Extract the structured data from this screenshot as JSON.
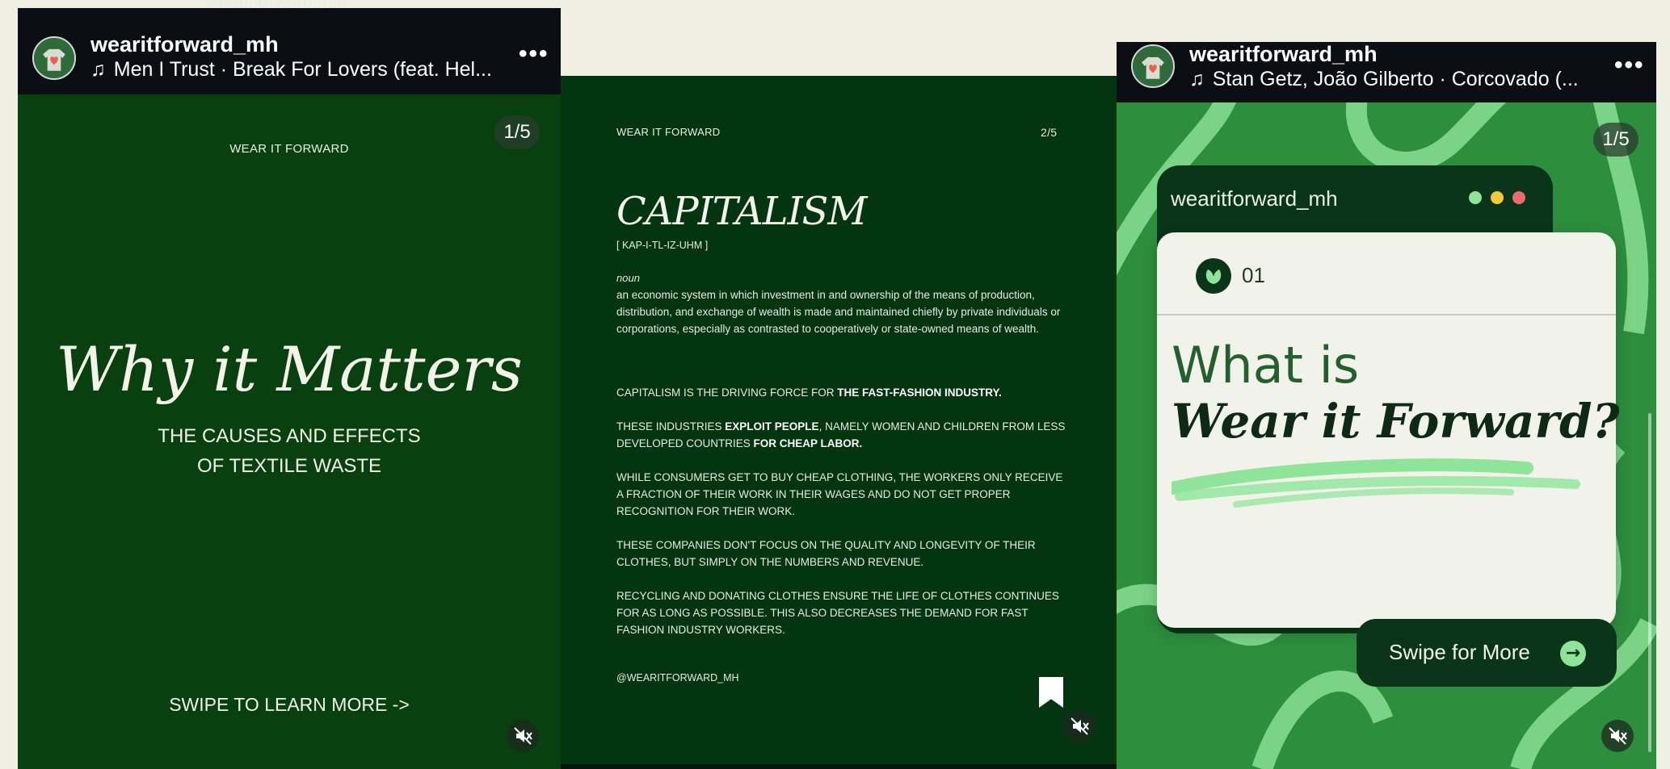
{
  "top_cutoff_text": "wearitforward_mh",
  "panel1": {
    "username": "wearitforward_mh",
    "song": "Men I Trust · Break For Lovers (feat. Hel...",
    "counter": "1/5",
    "brand": "WEAR IT FORWARD",
    "title": "Why it Matters",
    "subtitle_line1": "THE CAUSES AND EFFECTS",
    "subtitle_line2": "OF TEXTILE WASTE",
    "cta": "SWIPE TO LEARN MORE ->"
  },
  "panel2": {
    "brand": "WEAR IT FORWARD",
    "counter": "2/5",
    "heading": "CAPITALISM",
    "pronunciation": "[ KAP-I-TL-IZ-UHM ]",
    "pos": "noun",
    "definition": "an economic system in which investment in and ownership of the means of production, distribution, and exchange of wealth is made and maintained chiefly by private individuals or corporations, especially as contrasted to cooperatively or state-owned means of wealth.",
    "p1_a": "CAPITALISM IS THE DRIVING FORCE FOR ",
    "p1_b": "THE FAST-FASHION INDUSTRY.",
    "p2_a": "THESE INDUSTRIES ",
    "p2_b": "EXPLOIT PEOPLE",
    "p2_c": ", NAMELY WOMEN AND CHILDREN FROM LESS DEVELOPED COUNTRIES ",
    "p2_d": "FOR CHEAP LABOR.",
    "p3": "WHILE CONSUMERS GET TO BUY CHEAP CLOTHING, THE WORKERS ONLY RECEIVE A FRACTION OF THEIR WORK IN THEIR WAGES AND DO NOT GET PROPER RECOGNITION FOR THEIR WORK.",
    "p4": "THESE COMPANIES DON'T FOCUS ON THE QUALITY AND LONGEVITY OF THEIR CLOTHES, BUT SIMPLY ON THE NUMBERS AND REVENUE.",
    "p5": "RECYCLING AND DONATING CLOTHES ENSURE THE LIFE OF CLOTHES CONTINUES FOR AS LONG AS POSSIBLE. THIS ALSO DECREASES THE DEMAND FOR FAST FASHION INDUSTRY WORKERS.",
    "handle": "@WEARITFORWARD_MH"
  },
  "panel3": {
    "username": "wearitforward_mh",
    "song": "Stan Getz, João Gilberto · Corcovado (...",
    "counter": "1/5",
    "window_title": "wearitforward_mh",
    "number": "01",
    "line1": "What is",
    "line2": "Wear it Forward?",
    "cta": "Swipe for More"
  },
  "colors": {
    "panel_green": "#08410f",
    "panel2_green": "#043511",
    "panel3_green": "#2d8e3d",
    "accent_light_green": "#8ee59a",
    "header_black": "#0b0f14",
    "dot_green": "#8ee59a",
    "dot_yellow": "#f3c93a",
    "dot_red": "#ef6b6b"
  }
}
